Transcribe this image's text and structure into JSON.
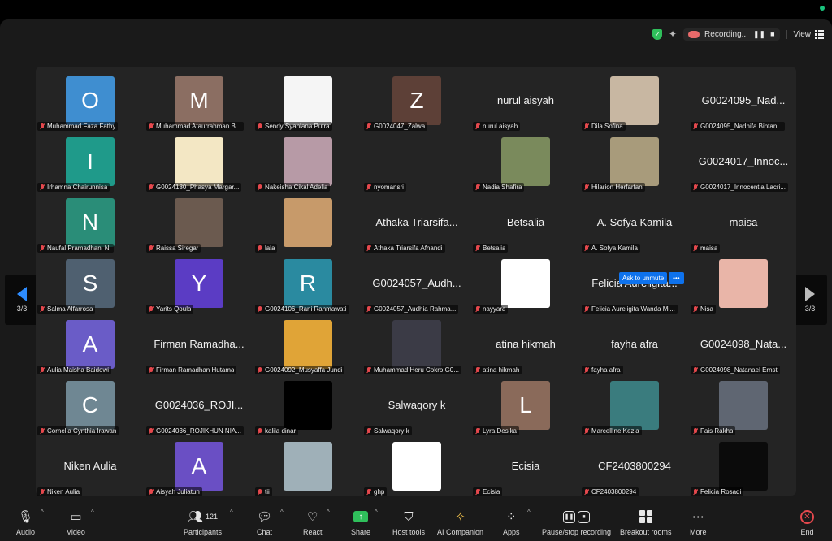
{
  "window": {
    "title": "Zoom Meeting"
  },
  "topbar": {
    "recording_label": "Recording...",
    "pause_glyph": "❚❚",
    "stop_glyph": "■",
    "view_label": "View",
    "sparkle_glyph": "✦",
    "shield_glyph": "✓"
  },
  "pagination": {
    "left_page": "3/3",
    "right_page": "3/3"
  },
  "unmute_popup": {
    "label": "Ask to unmute",
    "more": "•••"
  },
  "tiles": [
    {
      "name": "Muhammad Faza Fathy",
      "letter": "O",
      "avatar_color": "#3f8ed0",
      "big": ""
    },
    {
      "name": "Muhammad Ataurrahman B...",
      "letter": "M",
      "avatar_color": "#8b6e62",
      "big": ""
    },
    {
      "name": "Sendy Syahlana Putra",
      "letter": "",
      "avatar_color": "#f5f5f5",
      "big": ""
    },
    {
      "name": "G0024047_Zalwa",
      "letter": "Z",
      "avatar_color": "#5d4037",
      "big": ""
    },
    {
      "name": "nurul aisyah",
      "letter": "",
      "avatar_color": "",
      "big": "nurul aisyah"
    },
    {
      "name": "Dila Sofina",
      "letter": "",
      "avatar_color": "#c8b7a2",
      "big": ""
    },
    {
      "name": "G0024095_Nadhifa Bintan...",
      "letter": "",
      "avatar_color": "",
      "big": "G0024095_Nad..."
    },
    {
      "name": "Irhamna Chairunnisa",
      "letter": "I",
      "avatar_color": "#1f9a8a",
      "big": ""
    },
    {
      "name": "G0024180_Phasya Margar...",
      "letter": "",
      "avatar_color": "#f3e7c4",
      "big": ""
    },
    {
      "name": "Nakeisha Cikal Adelia",
      "letter": "",
      "avatar_color": "#b79aa6",
      "big": ""
    },
    {
      "name": "nyomansri",
      "letter": "",
      "avatar_color": "",
      "big": ""
    },
    {
      "name": "Nadia Shafira",
      "letter": "",
      "avatar_color": "#7a8a5c",
      "big": ""
    },
    {
      "name": "Hilarion Herfarfan",
      "letter": "",
      "avatar_color": "#a89b7b",
      "big": ""
    },
    {
      "name": "G0024017_Innocentia Lacri...",
      "letter": "",
      "avatar_color": "",
      "big": "G0024017_Innoc..."
    },
    {
      "name": "Naufal Pramadhani N.",
      "letter": "N",
      "avatar_color": "#2a8d78",
      "big": ""
    },
    {
      "name": "Raissa Siregar",
      "letter": "",
      "avatar_color": "#6b5a4f",
      "big": ""
    },
    {
      "name": "lala",
      "letter": "",
      "avatar_color": "#c79a6a",
      "big": ""
    },
    {
      "name": "Athaka Triarsifa Afnandi",
      "letter": "",
      "avatar_color": "",
      "big": "Athaka Triarsifa..."
    },
    {
      "name": "Betsalia",
      "letter": "",
      "avatar_color": "",
      "big": "Betsalia"
    },
    {
      "name": "A. Sofya Kamila",
      "letter": "",
      "avatar_color": "",
      "big": "A. Sofya Kamila"
    },
    {
      "name": "maisa",
      "letter": "",
      "avatar_color": "",
      "big": "maisa"
    },
    {
      "name": "Salma Alfarrosa",
      "letter": "S",
      "avatar_color": "#4f6070",
      "big": ""
    },
    {
      "name": "Yarits Qoula",
      "letter": "Y",
      "avatar_color": "#5b3cc4",
      "big": ""
    },
    {
      "name": "G0024106_Rani Rahmawati",
      "letter": "R",
      "avatar_color": "#2a8aa0",
      "big": ""
    },
    {
      "name": "G0024057_Audhia Rahma...",
      "letter": "",
      "avatar_color": "",
      "big": "G0024057_Audh..."
    },
    {
      "name": "nayyara",
      "letter": "",
      "avatar_color": "#ffffff",
      "big": ""
    },
    {
      "name": "Felicia Aureligita Wanda Mi...",
      "letter": "",
      "avatar_color": "",
      "big": "Felicia Aureligita..."
    },
    {
      "name": "Nisa",
      "letter": "",
      "avatar_color": "#e9b5a8",
      "big": ""
    },
    {
      "name": "Aulia Maisha Baidowi",
      "letter": "A",
      "avatar_color": "#6a5cc7",
      "big": ""
    },
    {
      "name": "Firman Ramadhan Hutama",
      "letter": "",
      "avatar_color": "",
      "big": "Firman Ramadha..."
    },
    {
      "name": "G0024092_Musyaffa Jundi",
      "letter": "",
      "avatar_color": "#e0a437",
      "big": ""
    },
    {
      "name": "Muhammad Heru Cokro G0...",
      "letter": "",
      "avatar_color": "#3b3b46",
      "big": ""
    },
    {
      "name": "atina hikmah",
      "letter": "",
      "avatar_color": "",
      "big": "atina hikmah"
    },
    {
      "name": "fayha afra",
      "letter": "",
      "avatar_color": "",
      "big": "fayha afra"
    },
    {
      "name": "G0024098_Natanael Ernst",
      "letter": "",
      "avatar_color": "",
      "big": "G0024098_Nata..."
    },
    {
      "name": "Cornelia Cynthia Irawan",
      "letter": "C",
      "avatar_color": "#6f8793",
      "big": ""
    },
    {
      "name": "G0024036_ROJIKHUN NIA...",
      "letter": "",
      "avatar_color": "",
      "big": "G0024036_ROJI..."
    },
    {
      "name": "kalila dinar",
      "letter": "",
      "avatar_color": "#000000",
      "big": ""
    },
    {
      "name": "Salwaqory k",
      "letter": "",
      "avatar_color": "",
      "big": "Salwaqory k"
    },
    {
      "name": "Lyra Desika",
      "letter": "L",
      "avatar_color": "#8a6a5a",
      "big": ""
    },
    {
      "name": "Marcelline Kezia",
      "letter": "",
      "avatar_color": "#3a7c7e",
      "big": ""
    },
    {
      "name": "Fais Rakha",
      "letter": "",
      "avatar_color": "#5f6672",
      "big": ""
    },
    {
      "name": "Niken Aulia",
      "letter": "",
      "avatar_color": "",
      "big": "Niken Aulia"
    },
    {
      "name": "Aisyah Juliatun",
      "letter": "A",
      "avatar_color": "#6a4fc4",
      "big": ""
    },
    {
      "name": "tii",
      "letter": "",
      "avatar_color": "#9fb0b8",
      "big": ""
    },
    {
      "name": "ghp",
      "letter": "",
      "avatar_color": "#ffffff",
      "big": ""
    },
    {
      "name": "Ecisia",
      "letter": "",
      "avatar_color": "",
      "big": "Ecisia"
    },
    {
      "name": "CF2403800294",
      "letter": "",
      "avatar_color": "",
      "big": "CF2403800294"
    },
    {
      "name": "Felicia Rosadi",
      "letter": "",
      "avatar_color": "#0b0b0b",
      "big": ""
    }
  ],
  "toolbar": {
    "audio": "Audio",
    "video": "Video",
    "participants": "Participants",
    "participants_count": "121",
    "chat": "Chat",
    "react": "React",
    "share": "Share",
    "host_tools": "Host tools",
    "ai_companion": "AI Companion",
    "apps": "Apps",
    "pause_stop_recording": "Pause/stop recording",
    "breakout_rooms": "Breakout rooms",
    "more": "More",
    "end": "End"
  },
  "icons": {
    "mic": "mic-icon",
    "camera": "camera-icon",
    "participants": "participants-icon",
    "chat": "chat-icon",
    "react": "heart-icon",
    "share": "share-icon",
    "host_tools": "shield-icon",
    "ai": "sparkle-icon",
    "apps": "apps-icon",
    "recording": "recording-icon",
    "breakout": "breakout-icon",
    "more": "more-icon",
    "end": "end-icon"
  }
}
